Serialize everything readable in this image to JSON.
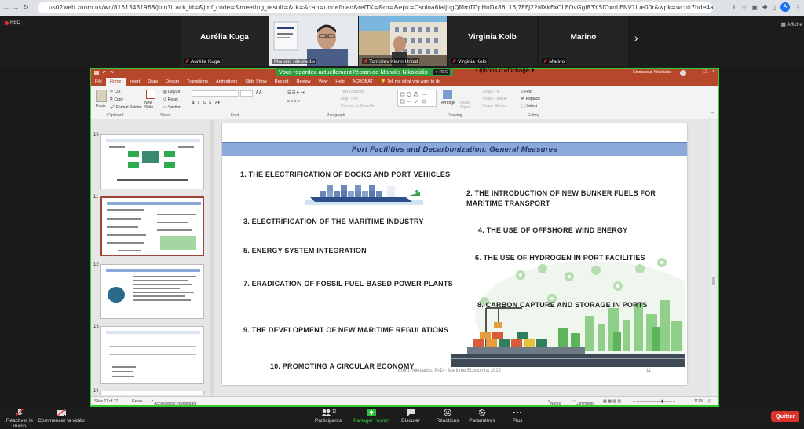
{
  "browser": {
    "url": "us02web.zoom.us/wc/81513431968/join?track_id=&jmf_code=&meeting_result=&tk=&cap=undefined&refTK=&rn=&epk=Osnloa6ialjngQMmTDpHoDx86L15j7EFJ22MXkFxOLEOvGgl83Y.SfOxnLENV1Iue00r&wpk=wcpk7bde4a7dcf15a3e94c7",
    "avatar_letter": "A"
  },
  "meeting": {
    "rec_label": "REC",
    "view_label": "Affiche",
    "participants": [
      {
        "big_name": "Aurélia Kuga",
        "name": "Aurélia Kuga",
        "type": "avatar"
      },
      {
        "big_name": "",
        "name": "Manolis Nikolaidis",
        "type": "video"
      },
      {
        "big_name": "",
        "name": "Tomislav Klarin Unizd",
        "type": "video"
      },
      {
        "big_name": "Virginia Kolb",
        "name": "Virginia Kolb",
        "type": "avatar"
      },
      {
        "big_name": "Marino",
        "name": "Marino",
        "type": "avatar"
      }
    ],
    "share_banner": "Vous regardez actuellement l'écran de Manolis Nikolaidis",
    "share_rec": "REC",
    "share_options": "Options d'affichage"
  },
  "ppt": {
    "user": "Emmanouil Nikolaidis",
    "tabs": [
      "File",
      "Home",
      "Insert",
      "Draw",
      "Design",
      "Transitions",
      "Animations",
      "Slide Show",
      "Record",
      "Review",
      "View",
      "Help",
      "ACROBAT",
      "Tell me what you want to do"
    ],
    "ribbon": {
      "clipboard": {
        "label": "Clipboard",
        "paste": "Paste",
        "cut": "Cut",
        "copy": "Copy",
        "format_painter": "Format Painter"
      },
      "slides": {
        "label": "Slides",
        "new_slide": "New Slide",
        "layout": "Layout",
        "reset": "Reset",
        "section": "Section"
      },
      "font": {
        "label": "Font"
      },
      "paragraph": {
        "label": "Paragraph",
        "text_direction": "Text Direction",
        "align_text": "Align Text",
        "smartart": "Convert to SmartArt"
      },
      "drawing": {
        "label": "Drawing",
        "arrange": "Arrange",
        "quick_styles": "Quick Styles",
        "shape_fill": "Shape Fill",
        "shape_outline": "Shape Outline",
        "shape_effects": "Shape Effects"
      },
      "editing": {
        "label": "Editing",
        "find": "Find",
        "replace": "Replace",
        "select": "Select"
      }
    },
    "thumbs": [
      {
        "num": "10"
      },
      {
        "num": "11"
      },
      {
        "num": "12"
      },
      {
        "num": "13"
      },
      {
        "num": "14"
      }
    ],
    "slide": {
      "title": "Port Facilities and Decarbonization: General Measures",
      "items": [
        "1. THE ELECTRIFICATION OF DOCKS AND PORT VEHICLES",
        "2. THE INTRODUCTION OF NEW BUNKER FUELS FOR",
        "MARITIME TRANSPORT",
        "3. ELECTRIFICATION OF THE MARITIME INDUSTRY",
        "4. THE USE OF OFFSHORE WIND ENERGY",
        "5. ENERGY SYSTEM INTEGRATION",
        "6. THE USE OF HYDROGEN IN PORT FACILITIES",
        "7. ERADICATION OF FOSSIL FUEL-BASED POWER PLANTS",
        "8. CARBON CAPTURE AND STORAGE IN PORTS",
        "9. THE DEVELOPMENT OF NEW MARITIME REGULATIONS",
        "10. PROMOTING A CIRCULAR ECONOMY"
      ],
      "footer": "Emm. Nikolaidis, PhD - Maritime Economist 2022",
      "page": "11"
    },
    "status": {
      "slide_of": "Slide 11 of 17",
      "language": "Greek",
      "accessibility": "Accessibility: Investigate",
      "notes": "Notes",
      "comments": "Comments",
      "zoom": "111%"
    }
  },
  "toolbar": {
    "mic_label": "Réactiver le micro",
    "video_label": "Commencer la vidéo",
    "participants_label": "Participants",
    "participants_count": "12",
    "share_label": "Partager l'écran",
    "chat_label": "Discuter",
    "react_label": "Réactions",
    "settings_label": "Paramètres",
    "more_label": "Plus",
    "quit_label": "Quitter"
  },
  "colors": {
    "ppt_accent": "#b7472a",
    "title_bar": "#8aa8d8",
    "zoom_green": "#2e9e3e",
    "quit_red": "#d9342b"
  }
}
